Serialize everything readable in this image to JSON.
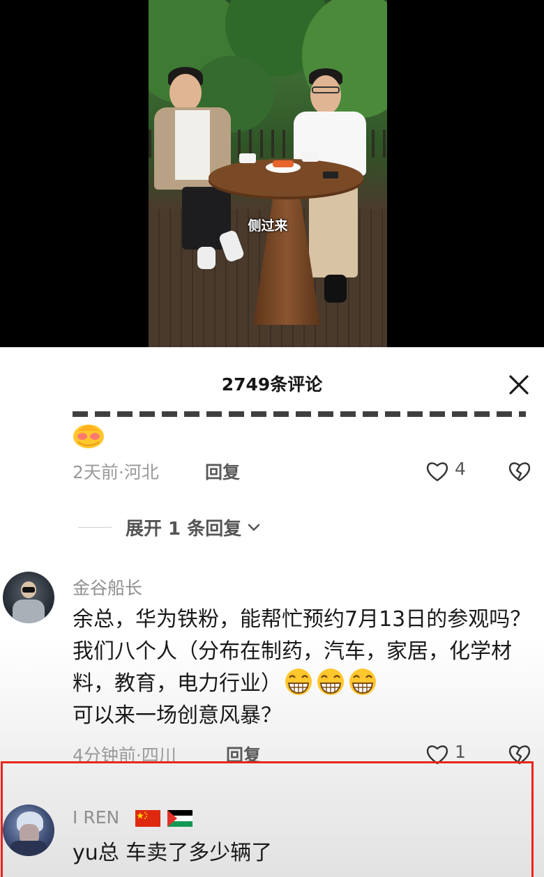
{
  "video": {
    "subtitle": "侧过来"
  },
  "comments_panel": {
    "title": "2749条评论",
    "close_icon": "close-icon"
  },
  "previous_comment": {
    "emoji": "blush-face-emoji",
    "time_location": "2天前·河北",
    "reply_label": "回复",
    "like_count": "4"
  },
  "expand_replies": {
    "label": "展开 1 条回复"
  },
  "comment_1": {
    "username": "金谷船长",
    "text": "余总，华为铁粉，能帮忙预约7月13日的参观吗？我们八个人（分布在制药，汽车，家居，化学材料，教育，电力行业）",
    "text_after_emoji": "可以来一场创意风暴？",
    "emojis": [
      "grin-emoji",
      "grin-emoji",
      "grin-emoji"
    ],
    "time_location": "4分钟前·四川",
    "reply_label": "回复",
    "like_count": "1"
  },
  "comment_2": {
    "username": "I REN",
    "flags": [
      "china-flag",
      "palestine-flag"
    ],
    "text": "yu总 车卖了多少辆了"
  },
  "colors": {
    "highlight_border": "#e8251b",
    "meta_gray": "#9a9a9a",
    "text_dark": "#1a1a1a"
  }
}
